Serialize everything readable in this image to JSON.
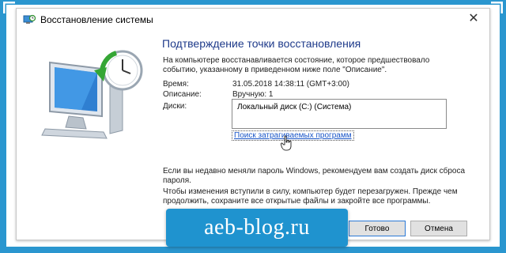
{
  "window": {
    "title": "Восстановление системы",
    "close_glyph": "✕"
  },
  "content": {
    "heading": "Подтверждение точки восстановления",
    "intro": "На компьютере восстанавливается состояние, которое предшествовало событию, указанному в приведенном ниже поле \"Описание\".",
    "time_label": "Время:",
    "time_value": "31.05.2018 14:38:11 (GMT+3:00)",
    "description_label": "Описание:",
    "description_value": "Вручную: 1",
    "disks_label": "Диски:",
    "disks": [
      "Локальный диск (C:) (Система)"
    ],
    "scan_link": "Поиск затрагиваемых программ",
    "note_password": "Если вы недавно меняли пароль Windows, рекомендуем вам создать диск сброса пароля.",
    "note_restart": "Чтобы изменения вступили в силу, компьютер будет перезагружен. Прежде чем продолжить, сохраните все открытые файлы и закройте все программы."
  },
  "buttons": {
    "ok": "Готово",
    "cancel": "Отмена"
  },
  "watermark": "aeb-blog.ru",
  "icons": [
    "system-restore-icon",
    "computer-clock-illustration",
    "close-icon",
    "hand-cursor-icon"
  ],
  "colors": {
    "background": "#2a96cf",
    "heading": "#1e3a8a",
    "link": "#1a56c8",
    "banner": "#1f93cf"
  }
}
